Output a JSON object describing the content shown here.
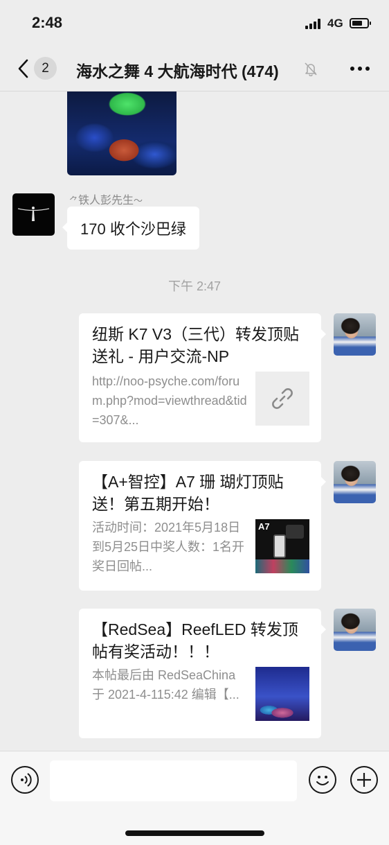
{
  "status": {
    "time": "2:48",
    "network": "4G"
  },
  "nav": {
    "badge": "2",
    "title": "海水之舞 4 大航海时代 (474)"
  },
  "messages": {
    "sender_name": "铁人彭先生",
    "text_message": "170 收个沙巴绿",
    "timestamp": "下午 2:47",
    "cards": [
      {
        "title": "纽斯 K7 V3（三代）转发顶贴送礼 - 用户交流-NP",
        "desc": "http://noo-psyche.com/forum.php?mod=viewthread&tid=307&...",
        "thumb_icon": "link-icon"
      },
      {
        "title": "【A+智控】A7 珊 瑚灯顶贴送！第五期开始！",
        "desc": "活动时间：2021年5月18日到5月25日中奖人数：1名开奖日回帖...",
        "thumb_label": "A7"
      },
      {
        "title": "【RedSea】ReefLED 转发顶帖有奖活动！！！",
        "desc": "本帖最后由 RedSeaChina 于 2021-4-115:42 编辑【..."
      }
    ]
  },
  "input": {
    "placeholder": ""
  },
  "colors": {
    "background": "#ededed",
    "bubble": "#ffffff",
    "secondary_text": "#8e8e8e"
  }
}
